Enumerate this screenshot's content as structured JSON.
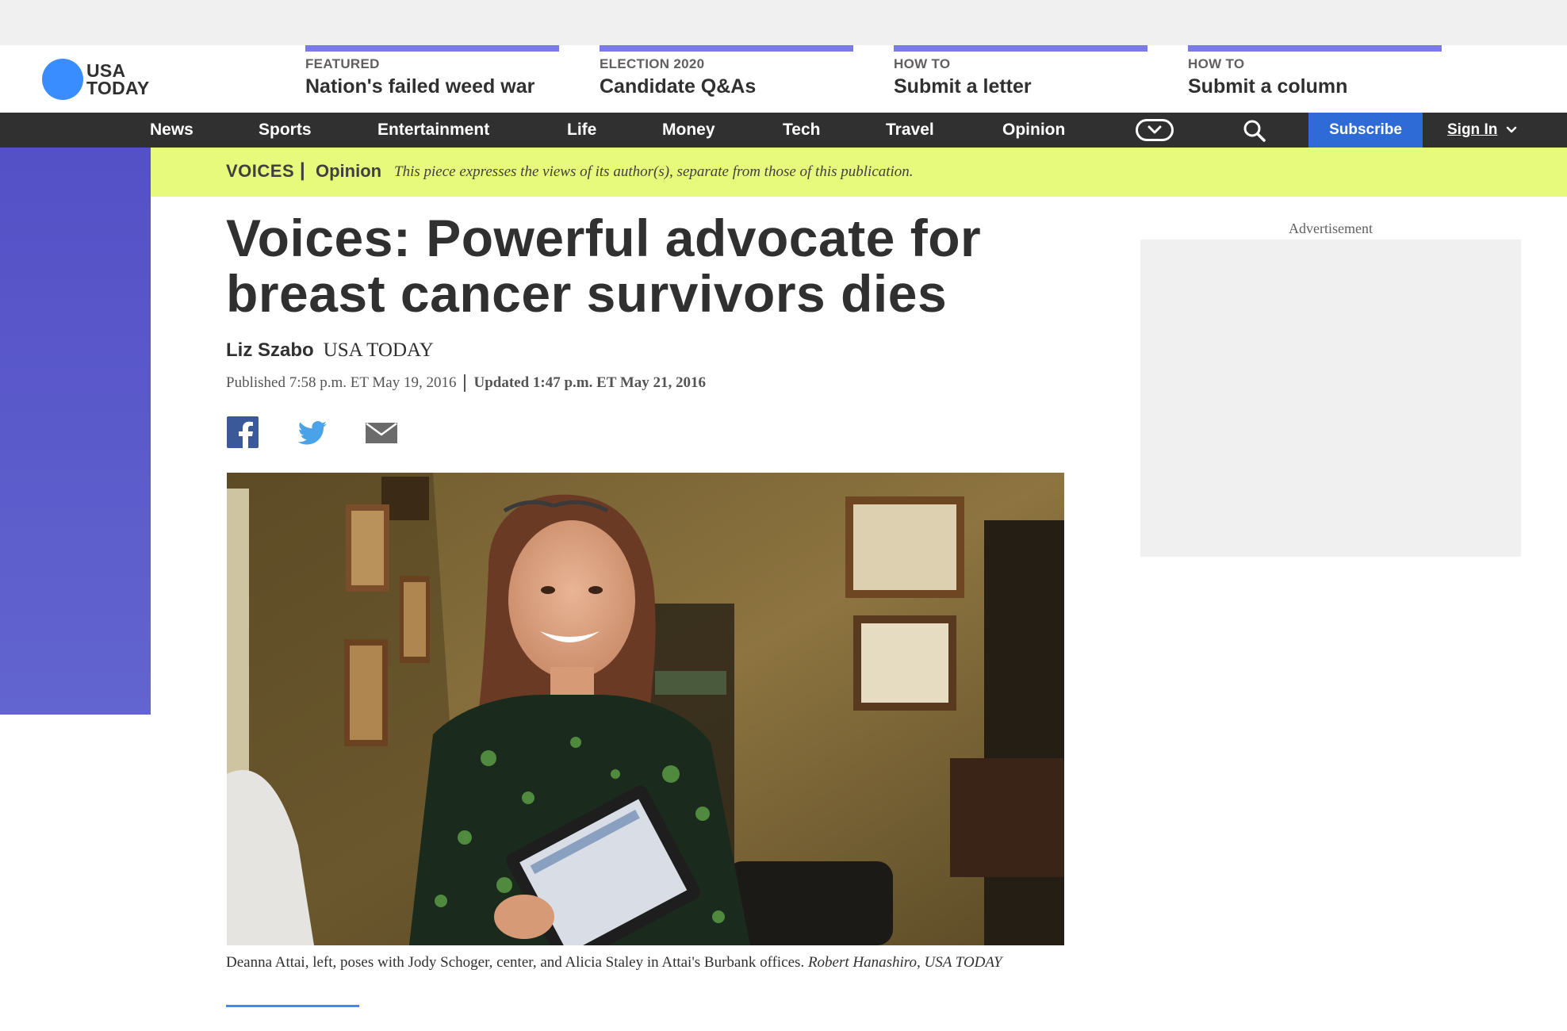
{
  "logo": {
    "line1": "USA",
    "line2": "TODAY",
    "circle_color": "#3a8dff"
  },
  "promos": [
    {
      "kicker": "FEATURED",
      "title": "Nation's failed weed war"
    },
    {
      "kicker": "ELECTION 2020",
      "title": "Candidate Q&As"
    },
    {
      "kicker": "HOW TO",
      "title": "Submit a letter"
    },
    {
      "kicker": "HOW TO",
      "title": "Submit a column"
    }
  ],
  "nav": {
    "items": [
      "News",
      "Sports",
      "Entertainment",
      "Life",
      "Money",
      "Tech",
      "Travel",
      "Opinion"
    ],
    "more_icon": "chevron-down-pill-icon",
    "search_icon": "search-icon",
    "subscribe_label": "Subscribe",
    "signin_label": "Sign In"
  },
  "opinion_banner": {
    "section": "VOICES",
    "separator": "|",
    "label": "Opinion",
    "note": "This piece expresses the views of its author(s), separate from those of this publication."
  },
  "article": {
    "headline": "Voices: Powerful advocate for breast cancer survivors dies",
    "author": "Liz Szabo",
    "publication": "USA TODAY",
    "published": "Published 7:58 p.m. ET May 19, 2016",
    "updated": "Updated 1:47 p.m. ET May 21, 2016",
    "share_icons": [
      "facebook-icon",
      "twitter-icon",
      "email-icon"
    ],
    "caption_text": "Deanna Attai, left, poses with Jody Schoger, center, and Alicia Staley in Attai's Burbank offices.",
    "caption_credit": "Robert Hanashiro, USA TODAY"
  },
  "ad": {
    "label": "Advertisement"
  },
  "colors": {
    "accent": "#7b7be6",
    "nav_bg": "#303030",
    "subscribe": "#2f6bd6",
    "banner": "#e7fa7c",
    "rail": "#5a5acb"
  }
}
